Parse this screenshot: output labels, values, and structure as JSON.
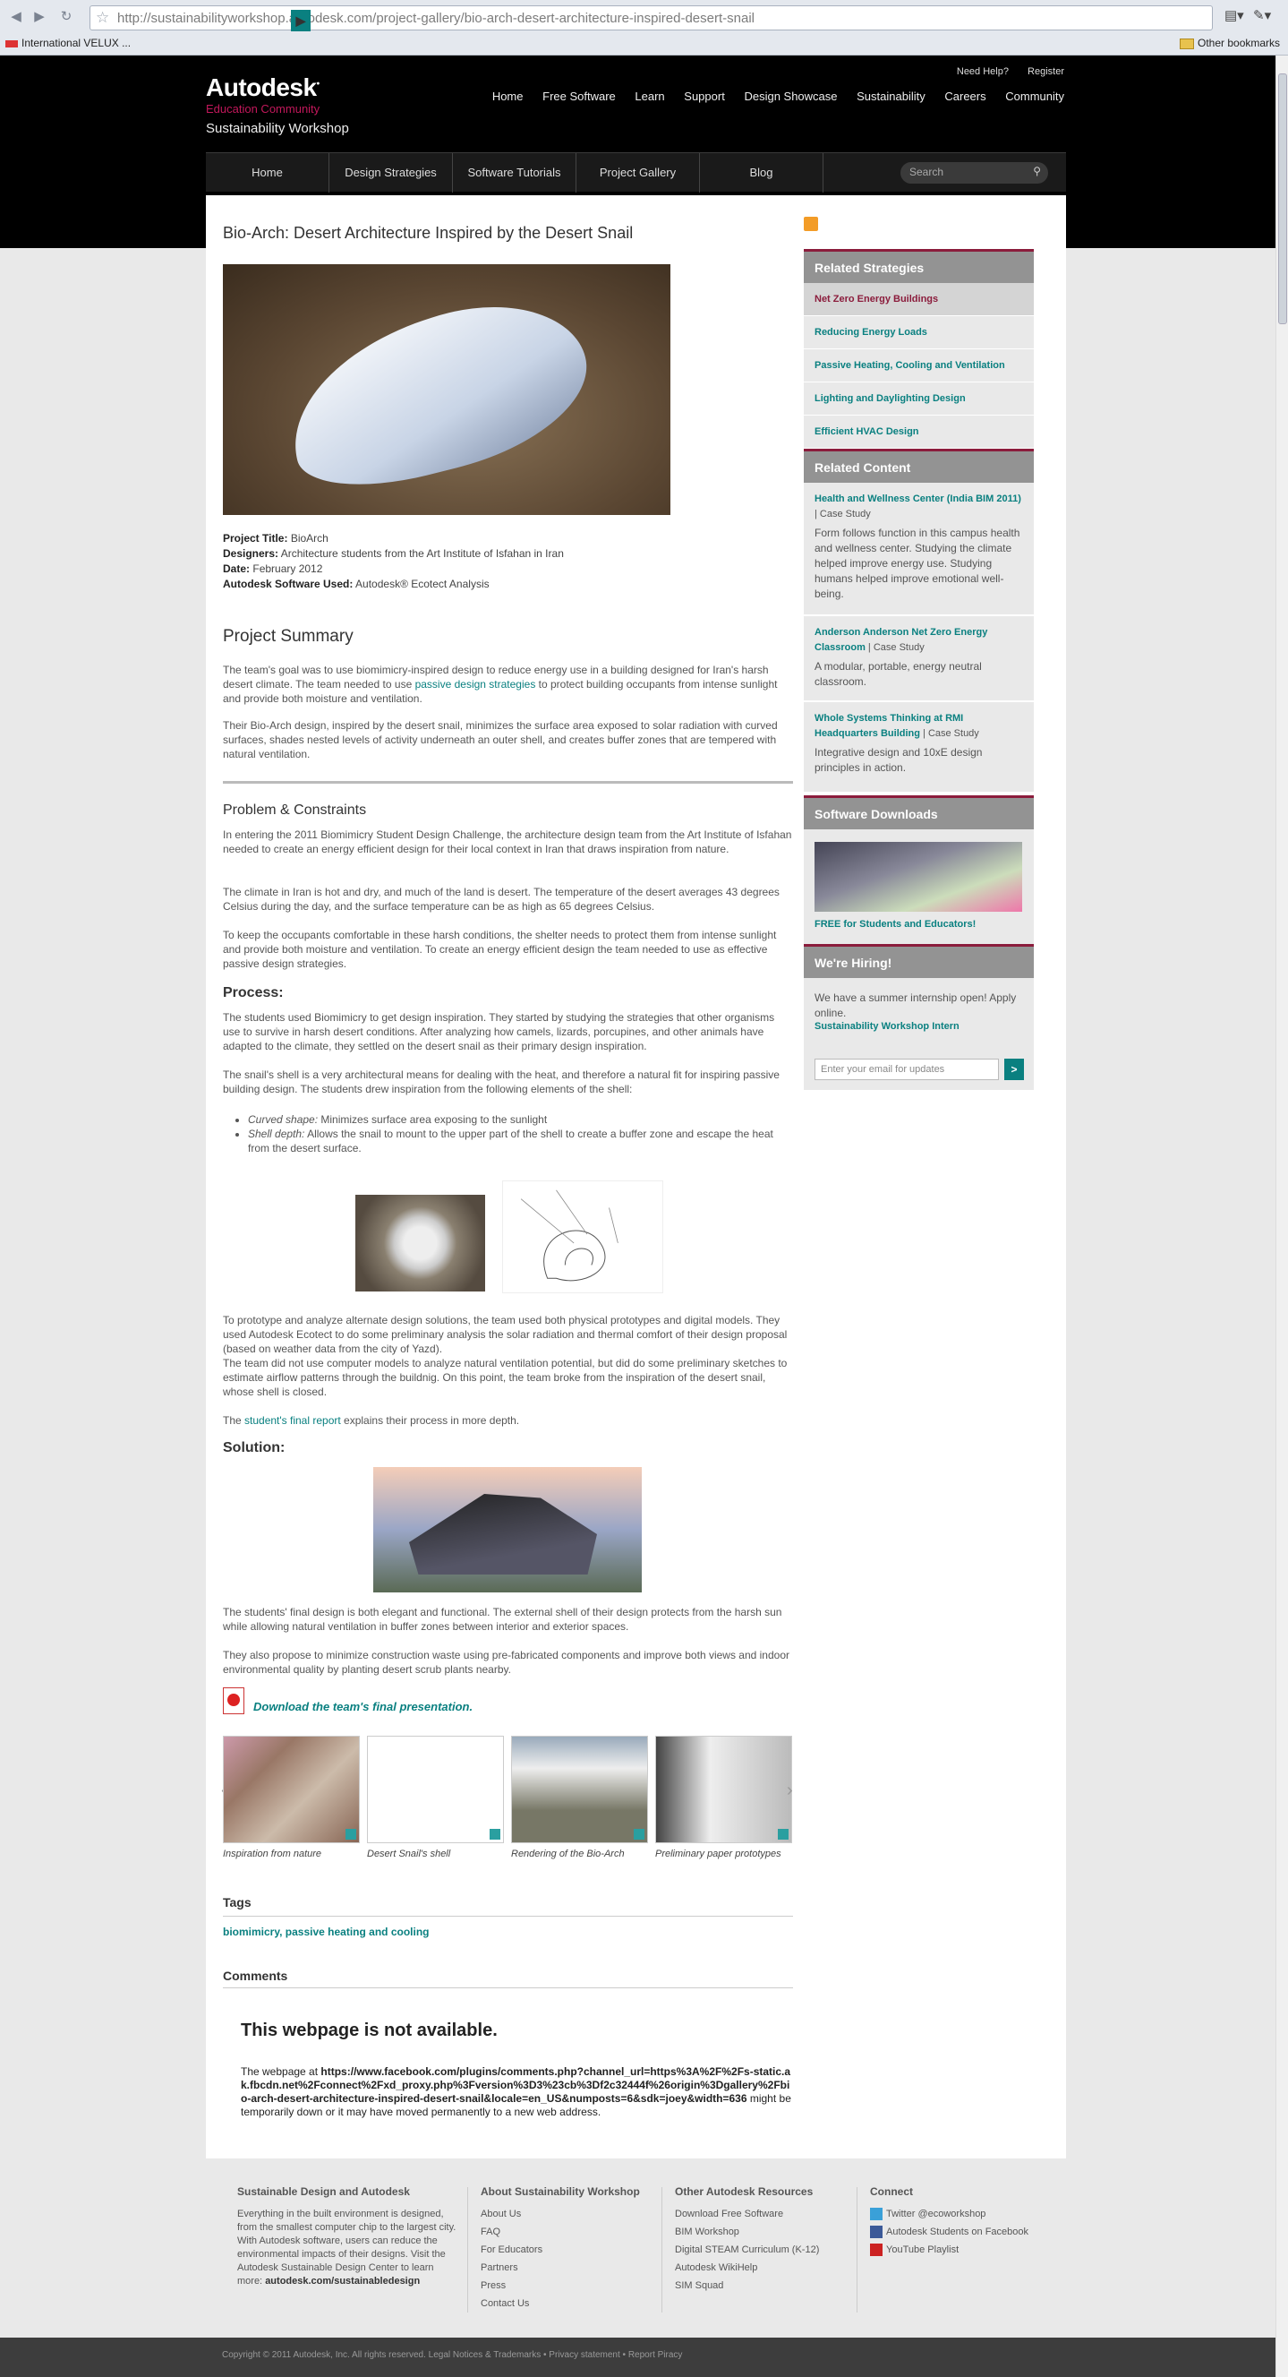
{
  "browser": {
    "url_host": "http://sustainabilityworkshop.autodesk.com",
    "url_path": "/project-gallery/bio-arch-desert-architecture-inspired-desert-snail",
    "bookmark_left": "International VELUX ...",
    "bookmark_right": "Other bookmarks"
  },
  "header": {
    "brand": "Autodesk",
    "edu": "Education Community",
    "site": "Sustainability Workshop",
    "toplinks": [
      "Need Help?",
      "Register"
    ],
    "mainnav": [
      "Home",
      "Free Software",
      "Learn",
      "Support",
      "Design Showcase",
      "Sustainability",
      "Careers",
      "Community"
    ],
    "subnav": [
      "Home",
      "Design Strategies",
      "Software Tutorials",
      "Project Gallery",
      "Blog"
    ],
    "search_placeholder": "Search"
  },
  "article": {
    "title": "Bio-Arch: Desert Architecture Inspired by the Desert Snail",
    "meta": [
      {
        "label": "Project Title:",
        "value": "BioArch"
      },
      {
        "label": "Designers:",
        "value": "Architecture students from the Art Institute of Isfahan in Iran"
      },
      {
        "label": "Date:",
        "value": "February 2012"
      },
      {
        "label": "Autodesk Software Used:",
        "value": "Autodesk® Ecotect Analysis"
      }
    ],
    "summary_title": "Project Summary",
    "summary_p1a": "The team's goal was to use biomimicry-inspired design to reduce energy use in a building designed for Iran's harsh desert climate. The team needed to use ",
    "summary_p1link": "passive design strategies",
    "summary_p1b": " to protect building occupants from intense sunlight and provide both moisture and ventilation.",
    "summary_p2": "Their Bio-Arch design, inspired by the desert snail, minimizes the surface area exposed to solar radiation with curved surfaces, shades nested levels of activity underneath an outer shell, and creates buffer zones that are tempered with natural ventilation.",
    "problem_title": "Problem & Constraints",
    "problem_p1": "In entering the 2011 Biomimicry Student Design Challenge, the architecture design team from the Art Institute of Isfahan needed to create an energy efficient design for their local context in Iran that draws inspiration from nature.",
    "problem_p2": "The climate in Iran is hot and dry, and much of the land is desert. The temperature of the desert averages 43 degrees Celsius during the day, and the surface temperature can be as high as 65 degrees Celsius.",
    "problem_p3": "To keep the occupants comfortable in these harsh conditions, the shelter needs to protect them from intense sunlight and provide both moisture and ventilation. To create an energy efficient design the team needed to use as effective passive design strategies.",
    "process_title": "Process:",
    "process_p1": "The students used Biomimicry to get design inspiration.  They started by studying the strategies that other organisms use to survive in harsh desert conditions. After analyzing how camels, lizards, porcupines, and other animals have adapted to the climate, they settled on the desert snail as their primary design inspiration.",
    "process_p2": "The snail's shell is a very architectural means for dealing with the heat, and therefore a natural fit for inspiring passive building design. The students drew inspiration from the following elements of the shell:",
    "bullets": [
      {
        "term": "Curved shape:",
        "text": " Minimizes surface area exposing to the sunlight"
      },
      {
        "term": "Shell depth:",
        "text": " Allows the snail to mount to the upper part of the shell to create a buffer zone and escape the heat from the desert surface."
      }
    ],
    "process_p3": "To prototype and analyze alternate design solutions, the team used both physical prototypes and digital models. They used Autodesk Ecotect to do some preliminary analysis the solar radiation and thermal comfort of their design proposal (based on weather data from the city of Yazd).",
    "process_p4": "The team did not use computer models to analyze natural ventilation potential, but did do some preliminary sketches to estimate airflow patterns through the buildnig. On this point, the team broke from the inspiration of the desert snail, whose shell is closed.",
    "report_pre": "The ",
    "report_link": "student's final report",
    "report_post": " explains their process in more depth.",
    "solution_title": "Solution:",
    "solution_p1": "The students' final design is both elegant and functional. The external shell of their design protects from the harsh sun while allowing natural ventilation in buffer zones between interior and exterior spaces.",
    "solution_p2": "They also propose to minimize construction waste using pre-fabricated components and improve both views and indoor environmental quality by planting desert scrub plants nearby.",
    "download_link": "Download the team's final presentation.",
    "gallery_captions": [
      "Inspiration from nature",
      "Desert Snail's shell",
      "Rendering of the Bio-Arch",
      "Preliminary paper prototypes"
    ],
    "tags_title": "Tags",
    "tags": "biomimicry, passive heating and cooling",
    "comments_title": "Comments",
    "na_title": "This webpage is not available.",
    "na_pre": "The webpage at ",
    "na_url": "https://www.facebook.com/plugins/comments.php?channel_url=https%3A%2F%2Fs-static.ak.fbcdn.net%2Fconnect%2Fxd_proxy.php%3Fversion%3D3%23cb%3Df2c32444f%26origin%3Dgallery%2Fbio-arch-desert-architecture-inspired-desert-snail&locale=en_US&numposts=6&sdk=joey&width=636",
    "na_post": " might be temporarily down or it may have moved permanently to a new web address."
  },
  "sidebar": {
    "related_strategies_title": "Related Strategies",
    "strategies": [
      "Net Zero Energy Buildings",
      "Reducing Energy Loads",
      "Passive Heating, Cooling and Ventilation",
      "Lighting and Daylighting Design",
      "Efficient HVAC Design"
    ],
    "related_content_title": "Related Content",
    "content": [
      {
        "title": "Health and Wellness Center (India BIM 2011)",
        "type": " | Case Study",
        "desc": "Form follows function in this campus health and wellness center. Studying the climate helped improve energy use. Studying humans helped improve emotional well-being."
      },
      {
        "title": "Anderson Anderson Net Zero Energy Classroom",
        "type": " | Case Study",
        "desc": "A modular, portable, energy neutral classroom."
      },
      {
        "title": "Whole Systems Thinking at RMI Headquarters Building",
        "type": " | Case Study",
        "desc": "Integrative design and 10xE design principles in action."
      }
    ],
    "downloads_title": "Software Downloads",
    "downloads_link": "FREE for Students and Educators!",
    "hiring_title": "We're Hiring!",
    "hiring_text": "We have a summer internship open! Apply online.",
    "hiring_link": "Sustainability Workshop Intern",
    "email_placeholder": "Enter your email for updates",
    "email_go": ">"
  },
  "footer": {
    "col1_title": "Sustainable Design and Autodesk",
    "col1_text": "Everything in the built environment is designed, from the smallest computer chip to the largest city. With Autodesk software, users can reduce the environmental impacts of their designs.  Visit the Autodesk Sustainable Design Center to learn more: ",
    "col1_link": "autodesk.com/sustainabledesign",
    "col2_title": "About Sustainability Workshop",
    "col2_links": [
      "About Us",
      "FAQ",
      "For Educators",
      "Partners",
      "Press",
      "Contact Us"
    ],
    "col3_title": "Other Autodesk Resources",
    "col3_links": [
      "Download Free Software",
      "BIM Workshop",
      "Digital STEAM Curriculum (K-12)",
      "Autodesk WikiHelp",
      "SIM Squad"
    ],
    "col4_title": "Connect",
    "col4_links": [
      "Twitter @ecoworkshop",
      "Autodesk Students on Facebook",
      "YouTube Playlist"
    ],
    "copyright": "Copyright © 2011 Autodesk, Inc. All rights reserved. Legal Notices & Trademarks • Privacy statement • Report Piracy"
  }
}
